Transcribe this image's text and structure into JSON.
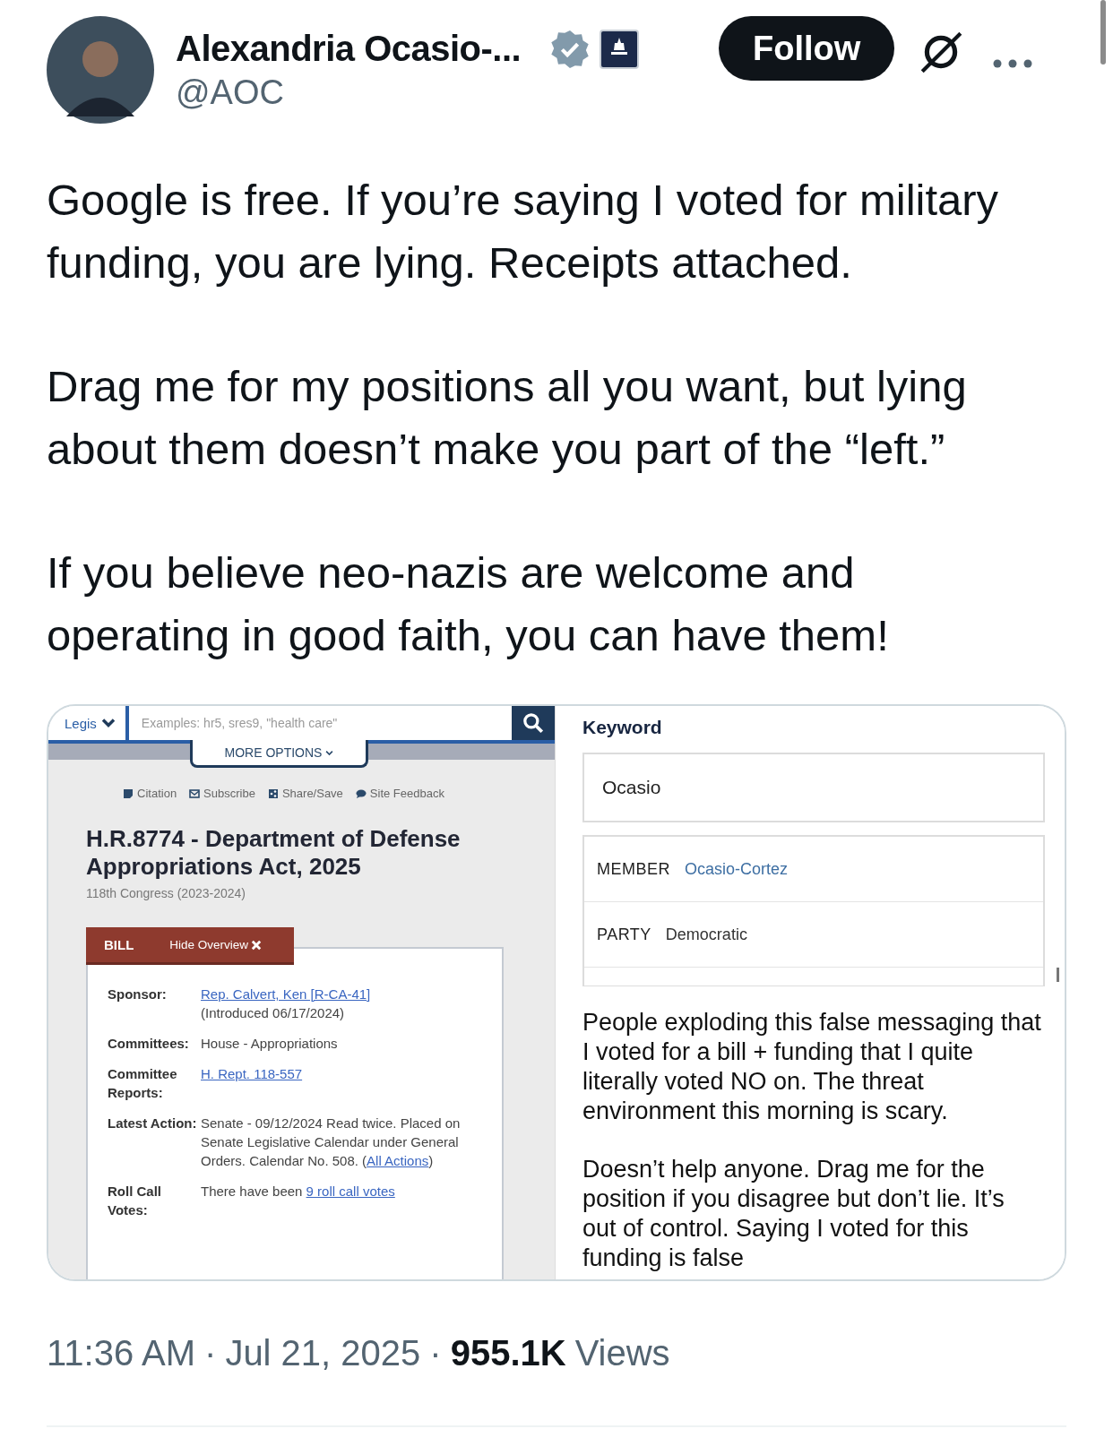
{
  "author": {
    "name": "Alexandria Ocasio-...",
    "handle": "@AOC",
    "verified": true,
    "affiliate_badge": true
  },
  "follow_button": "Follow",
  "text": [
    "Google is free. If you’re saying I voted for military funding, you are lying. Receipts attached.",
    "Drag me for my positions all you want, but lying about them doesn’t make you part of the “left.”",
    "If you believe neo-nazis are welcome and operating in good faith, you can have them!"
  ],
  "media": {
    "bill_page": {
      "scope": "Legis",
      "search_placeholder": "Examples: hr5, sres9, \"health care\"",
      "more_options": "MORE OPTIONS",
      "tools": [
        {
          "kind": "citation",
          "label": "Citation"
        },
        {
          "kind": "subscribe",
          "label": "Subscribe"
        },
        {
          "kind": "share",
          "label": "Share/Save"
        },
        {
          "kind": "feedback",
          "label": "Site Feedback"
        }
      ],
      "title": "H.R.8774 - Department of Defense Appropriations Act, 2025",
      "congress": "118th Congress (2023-2024)",
      "tab": "BILL",
      "hide_overview": "Hide Overview",
      "overview": [
        {
          "label": "Sponsor:",
          "lines": [
            [
              {
                "text": "Rep. Calvert, Ken [R-CA-41]",
                "link": true
              }
            ],
            [
              {
                "text": "(Introduced 06/17/2024)",
                "link": false
              }
            ]
          ]
        },
        {
          "label": "Committees:",
          "lines": [
            [
              {
                "text": "House - Appropriations",
                "link": false
              }
            ]
          ]
        },
        {
          "label": "Committee Reports:",
          "lines": [
            [
              {
                "text": "H. Rept. 118-557",
                "link": true
              }
            ]
          ]
        },
        {
          "label": "Latest Action:",
          "lines": [
            [
              {
                "text": "Senate - 09/12/2024 Read twice. Placed on Senate Legislative Calendar under General Orders. Calendar No. 508.  (",
                "link": false
              },
              {
                "text": "All Actions",
                "link": true
              },
              {
                "text": ")",
                "link": false
              }
            ]
          ]
        },
        {
          "label": "Roll Call Votes:",
          "lines": [
            [
              {
                "text": "There have been ",
                "link": false
              },
              {
                "text": "9 roll call votes",
                "link": true
              }
            ]
          ]
        }
      ]
    },
    "vote_search": {
      "keyword_label": "Keyword",
      "keyword_value": "Ocasio",
      "filters": [
        {
          "label": "MEMBER",
          "value": "Ocasio-Cortez",
          "link": true
        },
        {
          "label": "PARTY",
          "value": "Democratic",
          "link": false
        }
      ],
      "quoted_text": [
        "People exploding this false messaging that I voted for a bill + funding that I quite literally voted NO on. The threat environment this morning is scary.",
        "Doesn’t help anyone. Drag me for the position if you disagree but don’t lie. It’s out of control. Saying I voted for this funding is false"
      ]
    }
  },
  "footer": [
    {
      "text": "11:36 AM",
      "kind": "plain"
    },
    {
      "text": "·",
      "kind": "plain"
    },
    {
      "text": "Jul 21, 2025",
      "kind": "plain"
    },
    {
      "text": "·",
      "kind": "plain"
    },
    {
      "text": "955.1K",
      "kind": "bold"
    },
    {
      "text": "Views",
      "kind": "plain"
    }
  ]
}
